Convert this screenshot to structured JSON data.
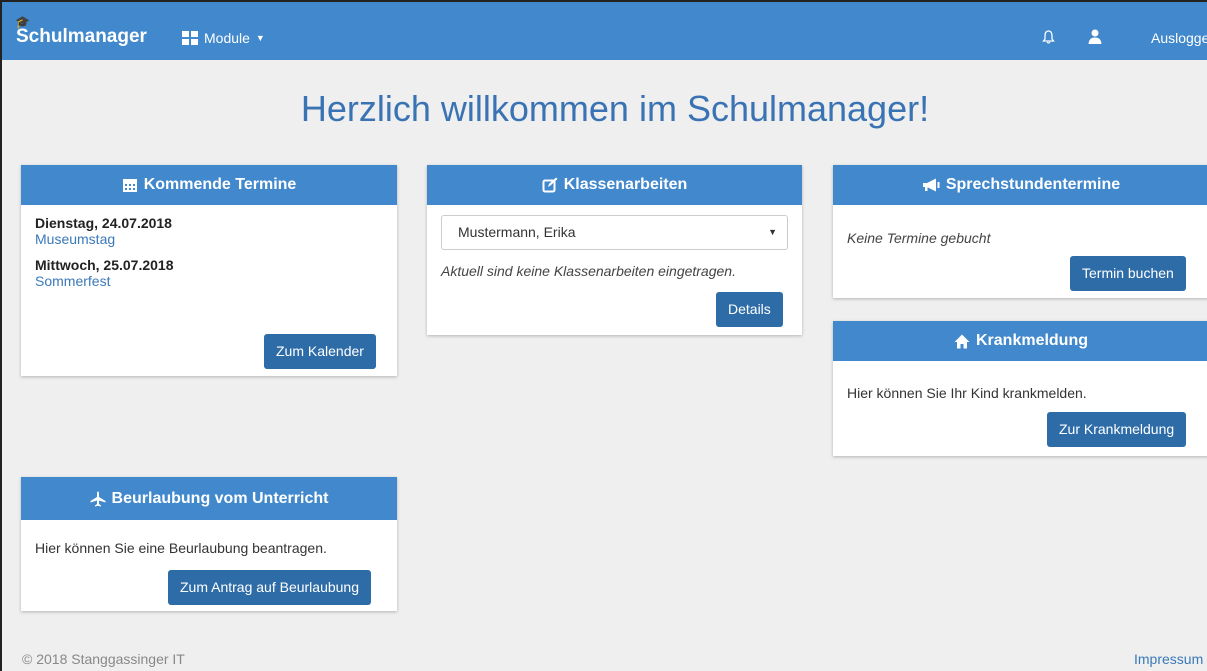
{
  "navbar": {
    "brand": "Schulmanager",
    "module_label": "Module",
    "logout_label": "Ausloggen",
    "bell_icon": "bell-icon",
    "user_icon": "user-icon",
    "color": "#4188cd"
  },
  "page": {
    "title": "Herzlich willkommen im Schulmanager!"
  },
  "termine": {
    "title": "Kommende Termine",
    "icon": "calendar-icon",
    "entries": [
      {
        "date": "Dienstag, 24.07.2018",
        "event": "Museumstag"
      },
      {
        "date": "Mittwoch, 25.07.2018",
        "event": "Sommerfest"
      }
    ],
    "button": "Zum Kalender"
  },
  "klassenarbeiten": {
    "title": "Klassenarbeiten",
    "icon": "edit-icon",
    "selected_student": "Mustermann, Erika",
    "message": "Aktuell sind keine Klassenarbeiten eingetragen.",
    "button": "Details"
  },
  "sprechstunden": {
    "title": "Sprechstundentermine",
    "icon": "megaphone-icon",
    "message": "Keine Termine gebucht",
    "button": "Termin buchen"
  },
  "krankmeldung": {
    "title": "Krankmeldung",
    "icon": "home-icon",
    "message": "Hier können Sie Ihr Kind krankmelden.",
    "button": "Zur Krankmeldung"
  },
  "beurlaubung": {
    "title": "Beurlaubung vom Unterricht",
    "icon": "plane-icon",
    "message": "Hier können Sie eine Beurlaubung beantragen.",
    "button": "Zum Antrag auf Beurlaubung"
  },
  "footer": {
    "copyright": "© 2018 Stanggassinger IT",
    "impressum": "Impressum"
  }
}
